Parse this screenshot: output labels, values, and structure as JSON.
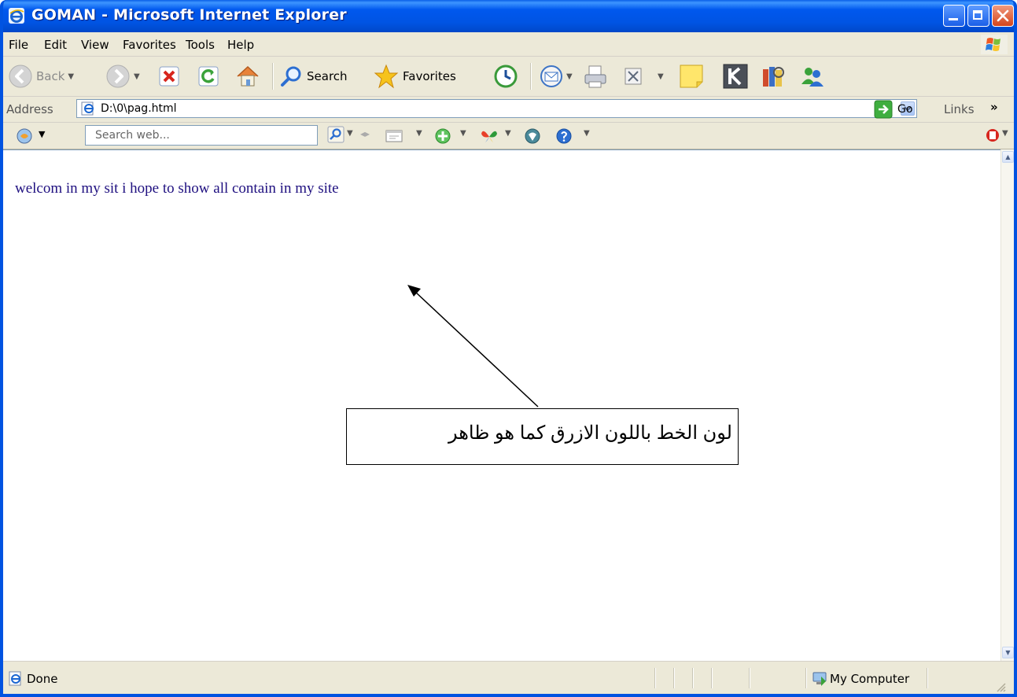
{
  "window": {
    "title": "GOMAN - Microsoft Internet Explorer"
  },
  "menu": {
    "items": [
      "File",
      "Edit",
      "View",
      "Favorites",
      "Tools",
      "Help"
    ]
  },
  "toolbar": {
    "back": "Back",
    "search": "Search",
    "favorites": "Favorites"
  },
  "address": {
    "label": "Address",
    "url": "D:\\0\\pag.html",
    "go": "Go",
    "links": "Links",
    "more": "»"
  },
  "search_toolbar": {
    "placeholder": "Search web..."
  },
  "page": {
    "welcome_text": "welcom in my sit i hope to show all contain in my site",
    "annotation": "لون الخط باللون الازرق كما هو ظاهر"
  },
  "status": {
    "text": "Done",
    "zone": "My Computer"
  },
  "colors": {
    "titlebar": "#0054e3",
    "welcome_text": "#1f1080",
    "chrome": "#ece9d8"
  }
}
